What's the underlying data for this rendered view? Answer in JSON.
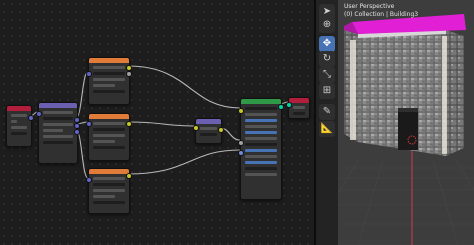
{
  "viewport": {
    "perspective_label": "User Perspective",
    "collection_label": "(0) Collection | Building3"
  },
  "tools": [
    {
      "name": "select",
      "icon": "cursor-icon",
      "glyph": "➤"
    },
    {
      "name": "cursor",
      "icon": "3d-cursor-icon",
      "glyph": "⊕"
    },
    {
      "name": "move",
      "icon": "move-icon",
      "glyph": "✥"
    },
    {
      "name": "rotate",
      "icon": "rotate-icon",
      "glyph": "↻"
    },
    {
      "name": "scale",
      "icon": "scale-icon",
      "glyph": "⤡"
    },
    {
      "name": "transform",
      "icon": "transform-icon",
      "glyph": "⊞"
    },
    {
      "name": "annotate",
      "icon": "annotate-icon",
      "glyph": "✎"
    },
    {
      "name": "measure",
      "icon": "measure-icon",
      "glyph": "📐"
    }
  ],
  "colors": {
    "group_input_header": "#b31e3c",
    "math_header": "#6a5fb1",
    "texture_header": "#e07b39",
    "mix_header": "#6a5fb1",
    "principled_header": "#2e9a47",
    "output_header": "#b31e3c",
    "link": "#b8b8b8",
    "magenta_face": "#e11fd4",
    "grid_x_axis": "#c83c50"
  }
}
